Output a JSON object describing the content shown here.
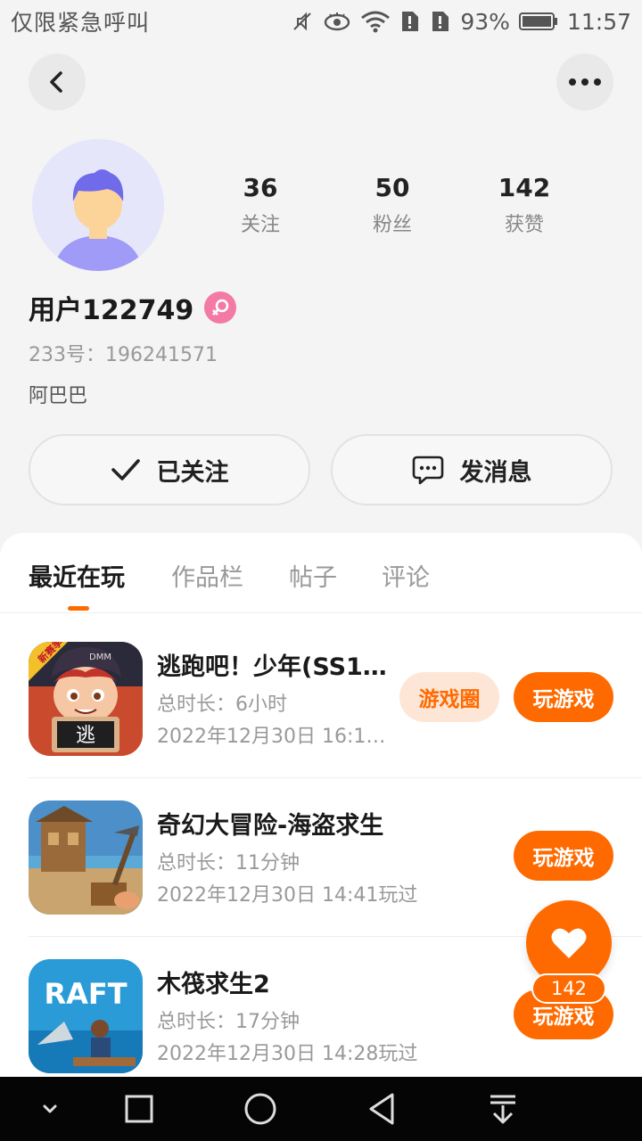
{
  "status_bar": {
    "carrier": "仅限紧急呼叫",
    "battery": "93%",
    "time": "11:57"
  },
  "profile": {
    "stats": [
      {
        "value": "36",
        "label": "关注"
      },
      {
        "value": "50",
        "label": "粉丝"
      },
      {
        "value": "142",
        "label": "获赞"
      }
    ],
    "username": "用户122749",
    "id_line": "233号：196241571",
    "bio": "阿巴巴",
    "gender_icon": "female-icon"
  },
  "actions": {
    "followed": "已关注",
    "message": "发消息"
  },
  "tabs": [
    "最近在玩",
    "作品栏",
    "帖子",
    "评论"
  ],
  "games": [
    {
      "title": "逃跑吧！少年(SS1…",
      "duration": "总时长：6小时",
      "last_played": "2022年12月30日 16:11…",
      "community_label": "游戏圈",
      "play_label": "玩游戏"
    },
    {
      "title": "奇幻大冒险-海盗求生",
      "duration": "总时长：11分钟",
      "last_played": "2022年12月30日 14:41玩过",
      "play_label": "玩游戏"
    },
    {
      "title": "木筏求生2",
      "duration": "总时长：17分钟",
      "last_played": "2022年12月30日 14:28玩过",
      "play_label": "玩游戏"
    }
  ],
  "icon_art": {
    "game1_badge": "新赛季",
    "game1_tag": "DMM",
    "game1_sign": "逃",
    "game3_logo": "RAFT"
  },
  "float_like": {
    "count": "142"
  },
  "colors": {
    "accent": "#ff6a00",
    "accent_light": "#fde6d6",
    "gender_badge": "#f37aa4",
    "avatar_bg": "#e6e6fb"
  }
}
